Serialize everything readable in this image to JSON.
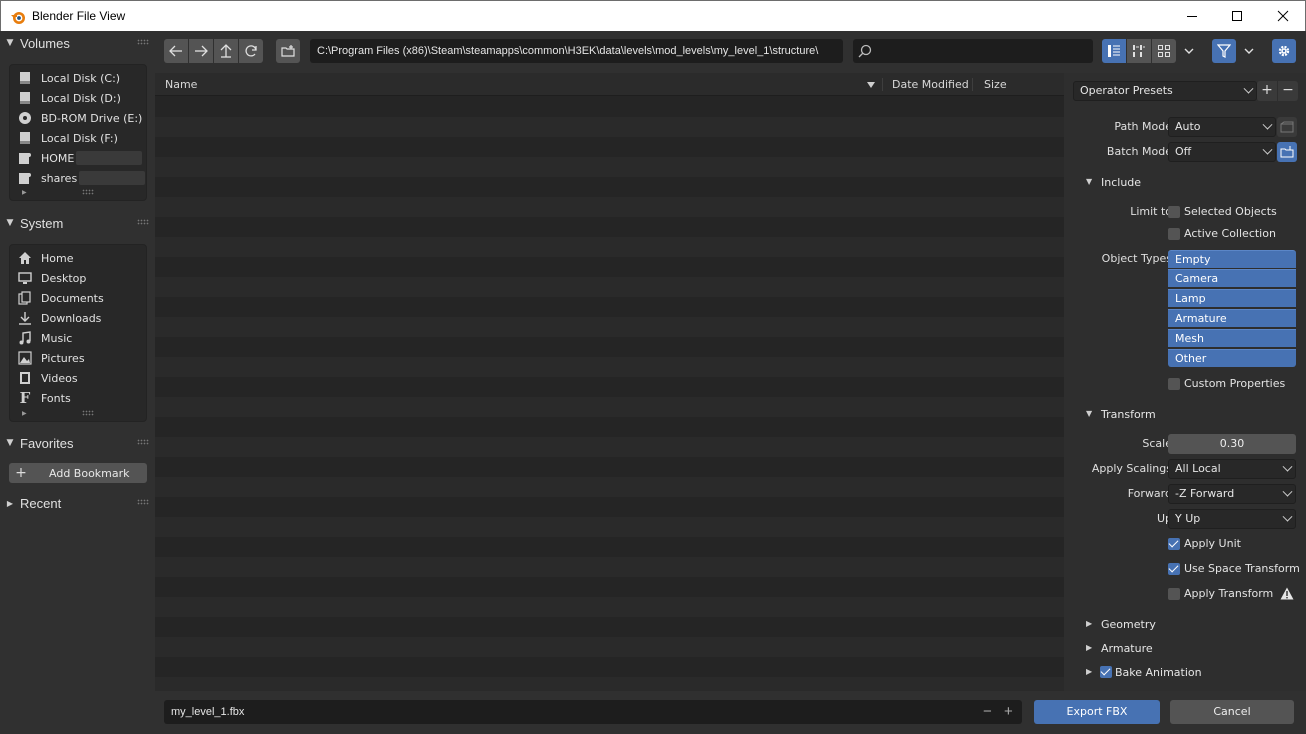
{
  "window": {
    "title": "Blender File View"
  },
  "sidebar": {
    "volumes": {
      "title": "Volumes",
      "items": [
        {
          "label": "Local Disk (C:)",
          "icon": "disk-icon"
        },
        {
          "label": "Local Disk (D:)",
          "icon": "disk-icon"
        },
        {
          "label": "BD-ROM Drive (E:)",
          "icon": "disc-icon"
        },
        {
          "label": "Local Disk (F:)",
          "icon": "disk-icon"
        },
        {
          "label": "HOME",
          "icon": "network-drive-icon"
        },
        {
          "label": "shares",
          "icon": "network-drive-icon"
        }
      ]
    },
    "system": {
      "title": "System",
      "items": [
        {
          "label": "Home",
          "icon": "home-icon"
        },
        {
          "label": "Desktop",
          "icon": "desktop-icon"
        },
        {
          "label": "Documents",
          "icon": "documents-icon"
        },
        {
          "label": "Downloads",
          "icon": "download-icon"
        },
        {
          "label": "Music",
          "icon": "music-icon"
        },
        {
          "label": "Pictures",
          "icon": "picture-icon"
        },
        {
          "label": "Videos",
          "icon": "video-icon"
        },
        {
          "label": "Fonts",
          "icon": "font-icon"
        }
      ]
    },
    "favorites": {
      "title": "Favorites",
      "add_bookmark": "Add Bookmark"
    },
    "recent": {
      "title": "Recent"
    }
  },
  "toolbar": {
    "path": "C:\\Program Files (x86)\\Steam\\steamapps\\common\\H3EK\\data\\levels\\mod_levels\\my_level_1\\structure\\",
    "search_placeholder": ""
  },
  "filelist": {
    "columns": {
      "name": "Name",
      "date": "Date Modified",
      "size": "Size"
    }
  },
  "panel": {
    "operator_presets": "Operator Presets",
    "path_mode": {
      "label": "Path Mode",
      "value": "Auto"
    },
    "batch_mode": {
      "label": "Batch Mode",
      "value": "Off"
    },
    "include": {
      "title": "Include",
      "limit_to": "Limit to",
      "selected_objects": {
        "label": "Selected Objects",
        "checked": false
      },
      "active_collection": {
        "label": "Active Collection",
        "checked": false
      },
      "object_types_label": "Object Types",
      "object_types": [
        "Empty",
        "Camera",
        "Lamp",
        "Armature",
        "Mesh",
        "Other"
      ],
      "custom_properties": {
        "label": "Custom Properties",
        "checked": false
      }
    },
    "transform": {
      "title": "Transform",
      "scale": {
        "label": "Scale",
        "value": "0.30"
      },
      "apply_scalings": {
        "label": "Apply Scalings",
        "value": "All Local"
      },
      "forward": {
        "label": "Forward",
        "value": "-Z Forward"
      },
      "up": {
        "label": "Up",
        "value": "Y Up"
      },
      "apply_unit": {
        "label": "Apply Unit",
        "checked": true
      },
      "use_space_transform": {
        "label": "Use Space Transform",
        "checked": true
      },
      "apply_transform": {
        "label": "Apply Transform",
        "checked": false
      }
    },
    "geometry": {
      "title": "Geometry"
    },
    "armature": {
      "title": "Armature"
    },
    "bake_animation": {
      "title": "Bake Animation",
      "checked": true
    }
  },
  "bottom": {
    "filename": "my_level_1.fbx",
    "export_label": "Export FBX",
    "cancel_label": "Cancel"
  },
  "colors": {
    "accent": "#4772b3",
    "background": "#303030",
    "field": "#1d1d1d"
  }
}
